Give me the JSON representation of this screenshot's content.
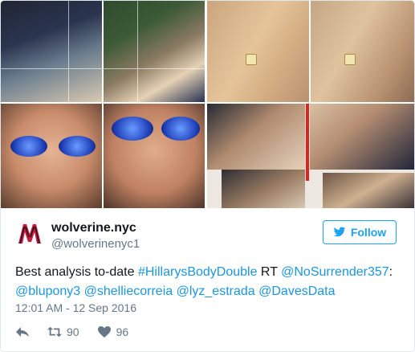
{
  "tweet": {
    "author": {
      "display_name": "wolverine.nyc",
      "handle": "@wolverinenyc1"
    },
    "follow_label": "Follow",
    "text": {
      "lead": "Best analysis to-date ",
      "hashtag": "#HillarysBodyDouble",
      "rt": " RT ",
      "mentions": [
        "@NoSurrender357",
        "@blupony3",
        "@shelliecorreia",
        "@lyz_estrada",
        "@DavesData"
      ]
    },
    "timestamp": "12:01 AM - 12 Sep 2016",
    "actions": {
      "retweet_count": "90",
      "like_count": "96"
    }
  },
  "icons": {
    "reply": "reply-icon",
    "retweet": "retweet-icon",
    "like": "heart-icon",
    "bird": "twitter-bird-icon"
  },
  "colors": {
    "link": "#1b95e0",
    "follow": "#1da1f2",
    "muted": "#657786",
    "text": "#14171a"
  }
}
